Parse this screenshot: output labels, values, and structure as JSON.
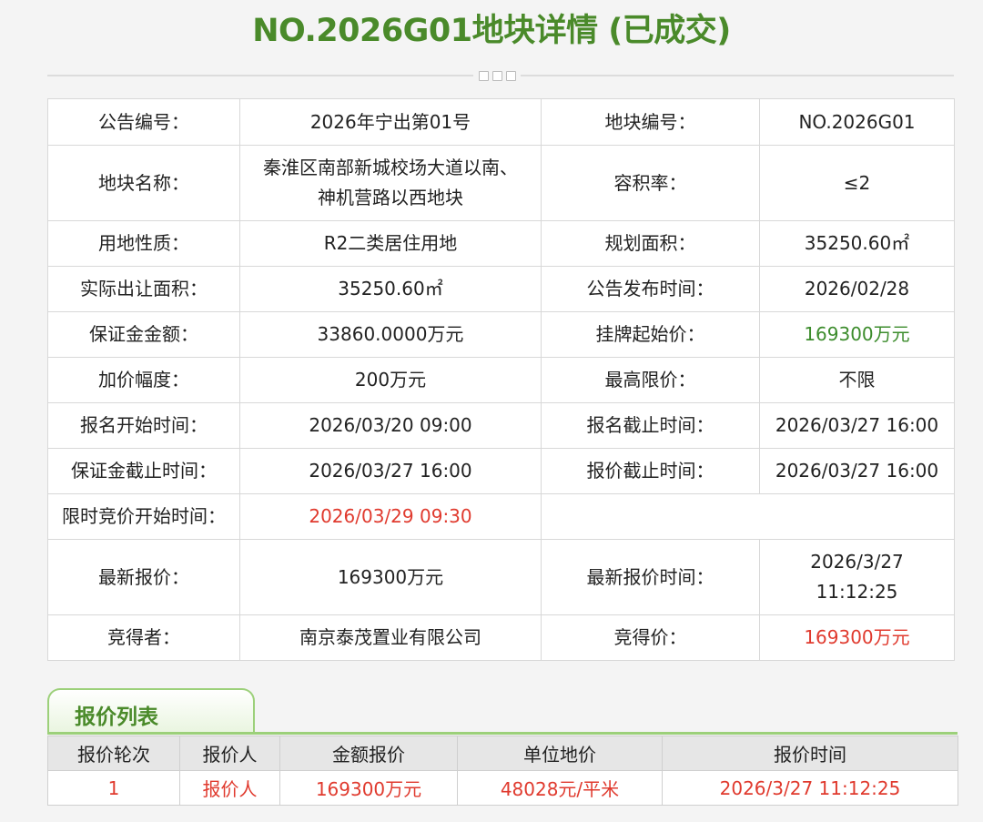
{
  "title": "NO.2026G01地块详情 (已成交)",
  "details": [
    {
      "l1": "公告编号：",
      "v1": "2026年宁出第01号",
      "l2": "地块编号：",
      "v2": "NO.2026G01"
    },
    {
      "l1": "地块名称：",
      "v1a": "秦淮区南部新城校场大道以南、",
      "v1b": "神机营路以西地块",
      "l2": "容积率：",
      "v2": "≤2"
    },
    {
      "l1": "用地性质：",
      "v1": "R2二类居住用地",
      "l2": "规划面积：",
      "v2": "35250.60㎡"
    },
    {
      "l1": "实际出让面积：",
      "v1": "35250.60㎡",
      "l2": "公告发布时间：",
      "v2": "2026/02/28"
    },
    {
      "l1": "保证金金额：",
      "v1": "33860.0000万元",
      "l2": "挂牌起始价：",
      "v2": "169300万元"
    },
    {
      "l1": "加价幅度：",
      "v1": "200万元",
      "l2": "最高限价：",
      "v2": "不限"
    },
    {
      "l1": "报名开始时间：",
      "v1": "2026/03/20 09:00",
      "l2": "报名截止时间：",
      "v2": "2026/03/27 16:00"
    },
    {
      "l1": "保证金截止时间：",
      "v1": "2026/03/27 16:00",
      "l2": "报价截止时间：",
      "v2": "2026/03/27 16:00"
    },
    {
      "l1": "限时竞价开始时间：",
      "v1": "2026/03/29 09:30"
    },
    {
      "l1": "最新报价：",
      "v1": "169300万元",
      "l2": "最新报价时间：",
      "v2a": "2026/3/27",
      "v2b": "11:12:25"
    },
    {
      "l1": "竞得者：",
      "v1": "南京泰茂置业有限公司",
      "l2": "竞得价：",
      "v2": "169300万元"
    }
  ],
  "bid_section": {
    "tab_label": "报价列表",
    "headers": [
      "报价轮次",
      "报价人",
      "金额报价",
      "单位地价",
      "报价时间"
    ],
    "rows": [
      [
        "1",
        "报价人",
        "169300万元",
        "48028元/平米",
        "2026/3/27 11:12:25"
      ]
    ]
  },
  "colors": {
    "title_green": "#4a8a2a",
    "highlight_red": "#e03a2e",
    "highlight_green": "#3c8c2c"
  }
}
